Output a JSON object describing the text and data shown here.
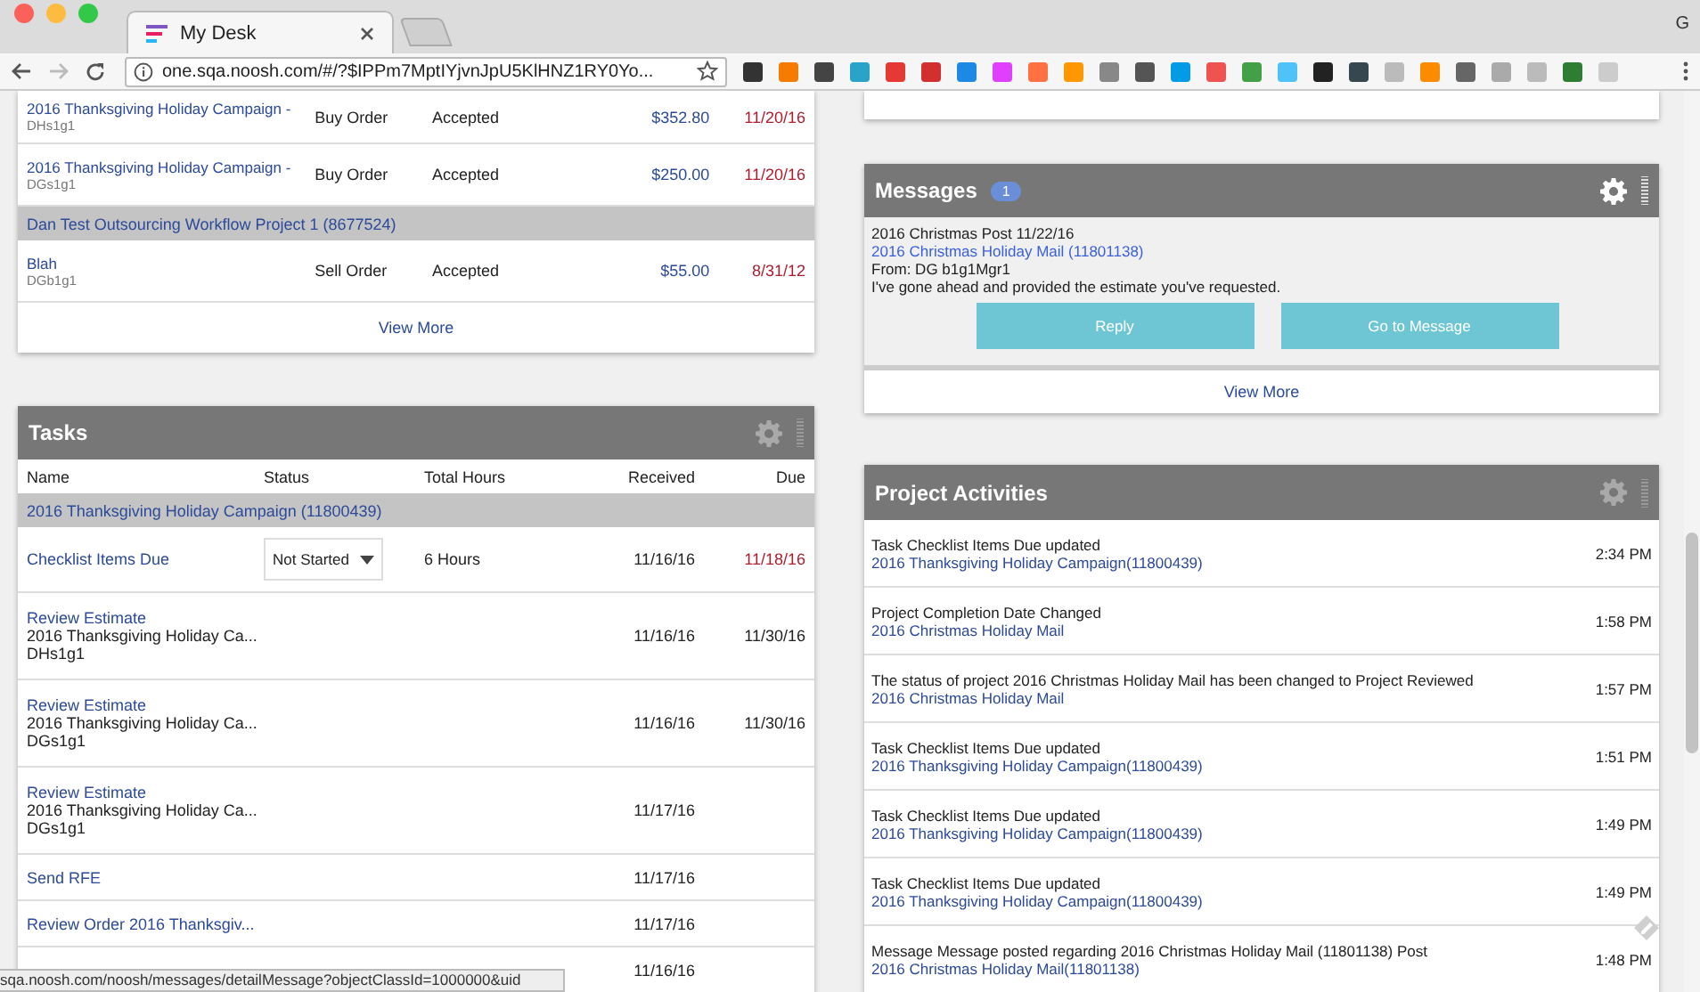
{
  "browser": {
    "tab_title": "My Desk",
    "url": "one.sqa.noosh.com/#/?$IPPm7MptIYjvnJpU5KlHNZ1RY0Yo...",
    "profile": "G"
  },
  "orders": {
    "rows": [
      {
        "kind": "order",
        "name": "2016 Thanksgiving Holiday Campaign -",
        "sub": "DHs1g1",
        "type": "Buy Order",
        "status": "Accepted",
        "amount": "$352.80",
        "date": "11/20/16",
        "overdue": true
      },
      {
        "kind": "order",
        "name": "2016 Thanksgiving Holiday Campaign -",
        "sub": "DGs1g1",
        "type": "Buy Order",
        "status": "Accepted",
        "amount": "$250.00",
        "date": "11/20/16",
        "overdue": true
      },
      {
        "kind": "group",
        "name": "Dan Test Outsourcing Workflow Project 1 (8677524)"
      },
      {
        "kind": "order",
        "name": "Blah",
        "sub": "DGb1g1",
        "type": "Sell Order",
        "status": "Accepted",
        "amount": "$55.00",
        "date": "8/31/12",
        "overdue": true
      }
    ],
    "view_more": "View More"
  },
  "tasks": {
    "title": "Tasks",
    "columns": [
      "Name",
      "Status",
      "Total Hours",
      "Received",
      "Due"
    ],
    "rows": [
      {
        "kind": "group",
        "name": "2016 Thanksgiving Holiday Campaign (11800439)"
      },
      {
        "kind": "task",
        "name": "Checklist Items Due",
        "status": "Not Started",
        "hours": "6 Hours",
        "received": "11/16/16",
        "due": "11/18/16",
        "overdue": true
      },
      {
        "kind": "task",
        "name": "Review Estimate",
        "project": "2016 Thanksgiving Holiday Ca...",
        "owner": "DHs1g1",
        "received": "11/16/16",
        "due": "11/30/16",
        "overdue": false
      },
      {
        "kind": "task",
        "name": "Review Estimate",
        "project": "2016 Thanksgiving Holiday Ca...",
        "owner": "DGs1g1",
        "received": "11/16/16",
        "due": "11/30/16",
        "overdue": false
      },
      {
        "kind": "task",
        "name": "Review Estimate",
        "project": "2016 Thanksgiving Holiday Ca...",
        "owner": "DGs1g1",
        "received": "11/17/16"
      },
      {
        "kind": "task",
        "name": "Send RFE",
        "received": "11/17/16"
      },
      {
        "kind": "task",
        "name": "Review Order 2016 Thanksgiv...",
        "received": "11/17/16"
      },
      {
        "kind": "task",
        "received": "11/16/16"
      }
    ]
  },
  "messages": {
    "title": "Messages",
    "count": "1",
    "items": [
      {
        "subject": "2016 Christmas Post 11/22/16",
        "link": "2016 Christmas Holiday Mail (11801138)",
        "from": "From: DG b1g1Mgr1",
        "body": "I've gone ahead and provided the estimate you've requested."
      }
    ],
    "buttons": [
      "Reply",
      "Go to Message"
    ],
    "view_more": "View More"
  },
  "activities": {
    "title": "Project Activities",
    "items": [
      {
        "text": "Task Checklist Items Due updated",
        "link": "2016 Thanksgiving Holiday Campaign(11800439)",
        "time": "2:34 PM"
      },
      {
        "text": "Project Completion Date Changed",
        "link": "2016 Christmas Holiday Mail",
        "time": "1:58 PM"
      },
      {
        "text": "The status of project 2016 Christmas Holiday Mail has been changed to Project Reviewed",
        "link": "2016 Christmas Holiday Mail",
        "time": "1:57 PM"
      },
      {
        "text": "Task Checklist Items Due updated",
        "link": "2016 Thanksgiving Holiday Campaign(11800439)",
        "time": "1:51 PM"
      },
      {
        "text": "Task Checklist Items Due updated",
        "link": "2016 Thanksgiving Holiday Campaign(11800439)",
        "time": "1:49 PM"
      },
      {
        "text": "Task Checklist Items Due updated",
        "link": "2016 Thanksgiving Holiday Campaign(11800439)",
        "time": "1:49 PM"
      },
      {
        "text": "Message Message posted regarding 2016 Christmas Holiday Mail (11801138) Post",
        "link": "2016 Christmas Holiday Mail(11801138)",
        "time": "1:48 PM"
      }
    ]
  },
  "status_bar": "sqa.noosh.com/noosh/messages/detailMessage?objectClassId=1000000&uid"
}
